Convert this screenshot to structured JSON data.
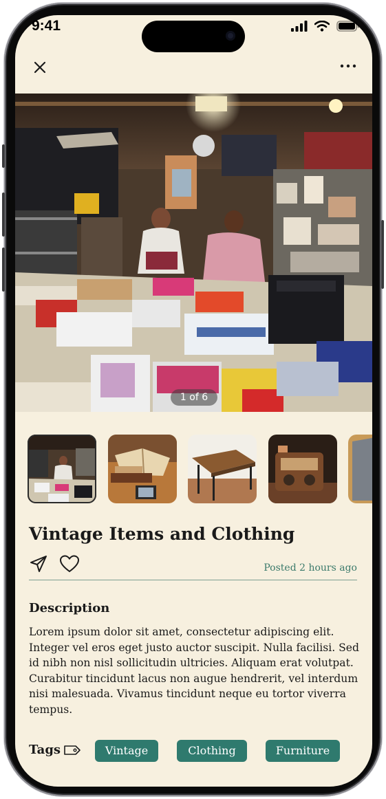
{
  "status_bar": {
    "time": "9:41"
  },
  "nav": {
    "close_icon": "close-icon",
    "more_icon": "more-horizontal-icon"
  },
  "gallery": {
    "counter": "1 of 6",
    "current": 1,
    "total": 6,
    "thumbnails": [
      "garage-sale",
      "books",
      "wooden-table",
      "vintage-radio",
      "clothing"
    ]
  },
  "listing": {
    "title": "Vintage Items and Clothing",
    "posted": "Posted 2 hours ago",
    "description_heading": "Description",
    "description": "Lorem ipsum dolor sit amet, consectetur adipiscing elit. Integer vel eros eget justo auctor suscipit. Nulla facilisi. Sed id nibh non nisl sollicitudin ultricies. Aliquam erat volutpat. Curabitur tincidunt lacus non augue hendrerit, vel interdum nisi malesuada. Vivamus tincidunt neque eu tortor viverra tempus.",
    "tags_label": "Tags",
    "tags": [
      "Vintage",
      "Clothing",
      "Furniture"
    ]
  },
  "colors": {
    "background": "#f7f0df",
    "accent": "#2f7a6e",
    "posted_text": "#3b7a6b"
  }
}
